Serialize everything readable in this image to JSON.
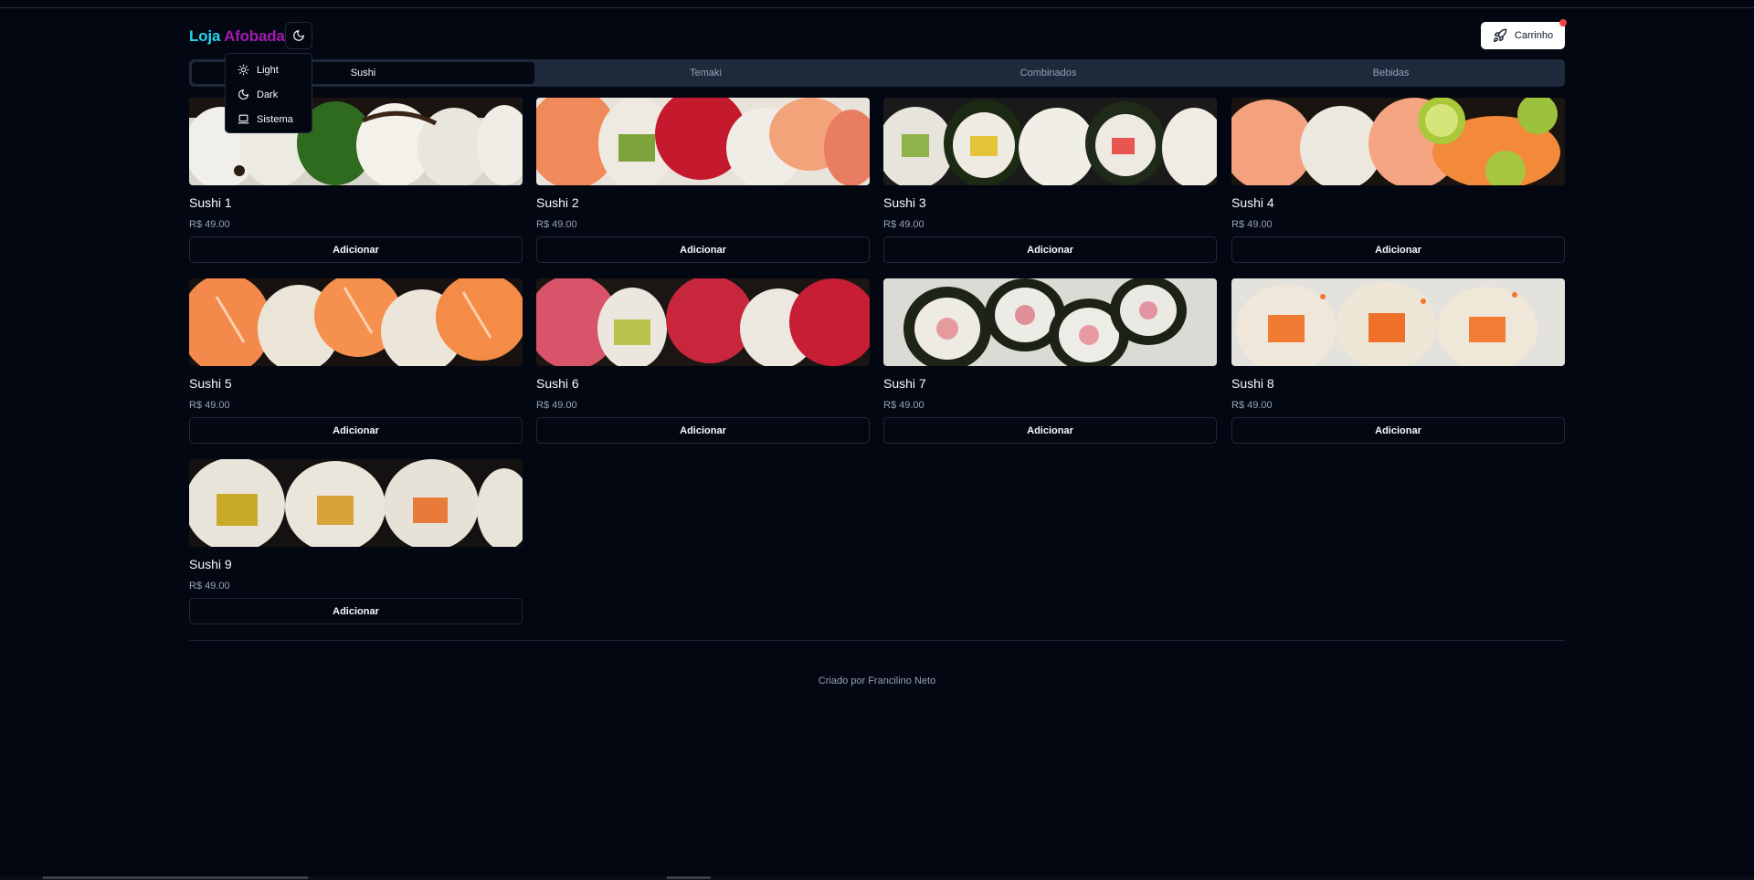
{
  "brand": {
    "part1": "Loja",
    "part2": "Afobada"
  },
  "cart": {
    "label": "Carrinho"
  },
  "theme_menu": [
    {
      "label": "Light",
      "icon": "sun-icon"
    },
    {
      "label": "Dark",
      "icon": "moon-icon"
    },
    {
      "label": "Sistema",
      "icon": "laptop-icon"
    }
  ],
  "tabs": [
    {
      "label": "Sushi",
      "active": true
    },
    {
      "label": "Temaki",
      "active": false
    },
    {
      "label": "Combinados",
      "active": false
    },
    {
      "label": "Bebidas",
      "active": false
    }
  ],
  "products": [
    {
      "name": "Sushi 1",
      "price": "R$ 49.00",
      "button": "Adicionar"
    },
    {
      "name": "Sushi 2",
      "price": "R$ 49.00",
      "button": "Adicionar"
    },
    {
      "name": "Sushi 3",
      "price": "R$ 49.00",
      "button": "Adicionar"
    },
    {
      "name": "Sushi 4",
      "price": "R$ 49.00",
      "button": "Adicionar"
    },
    {
      "name": "Sushi 5",
      "price": "R$ 49.00",
      "button": "Adicionar"
    },
    {
      "name": "Sushi 6",
      "price": "R$ 49.00",
      "button": "Adicionar"
    },
    {
      "name": "Sushi 7",
      "price": "R$ 49.00",
      "button": "Adicionar"
    },
    {
      "name": "Sushi 8",
      "price": "R$ 49.00",
      "button": "Adicionar"
    },
    {
      "name": "Sushi 9",
      "price": "R$ 49.00",
      "button": "Adicionar"
    }
  ],
  "footer": {
    "text": "Criado por Francilino Neto"
  },
  "colors": {
    "background": "#030711",
    "brand_part1": "#22d3ee",
    "brand_part2": "#a21caf",
    "cart_badge": "#ef4444"
  }
}
